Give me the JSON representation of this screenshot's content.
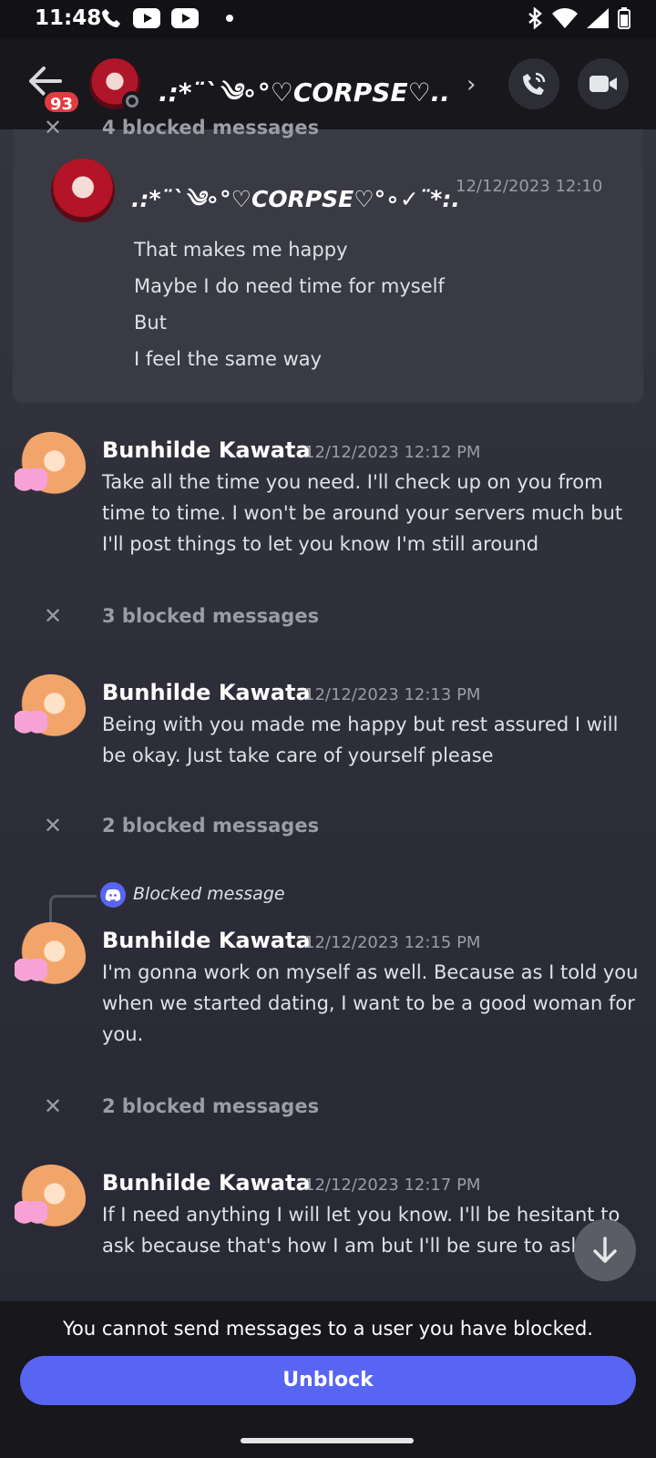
{
  "status_bar": {
    "time": "11:48"
  },
  "header": {
    "unread_badge": "93",
    "title": ".:*¨`༄∘°♡CORPSE♡...",
    "chevron": "›"
  },
  "context": {
    "cut_label": "4 blocked messages",
    "author": ".:*¨`༄∘°♡CORPSE♡°∘✓¨*:.",
    "timestamp": "12/12/2023 12:10",
    "lines": [
      "That makes me happy",
      "Maybe I do need time for myself",
      "But",
      "I feel the same way"
    ]
  },
  "messages": [
    {
      "author": "Bunhilde Kawata",
      "timestamp": "12/12/2023 12:12 PM",
      "text": "Take all the time you need. I'll check up on you from time to time. I won't be around your servers much but I'll post things to let you know I'm still around"
    },
    {
      "author": "Bunhilde Kawata",
      "timestamp": "12/12/2023 12:13 PM",
      "text": "Being with you made me happy but rest assured I will be okay. Just take care of yourself please"
    },
    {
      "author": "Bunhilde Kawata",
      "timestamp": "12/12/2023 12:15 PM",
      "text": "I'm gonna work on myself as well. Because as I told you when we started dating, I want to be a good woman for you."
    },
    {
      "author": "Bunhilde Kawata",
      "timestamp": "12/12/2023 12:17 PM",
      "text": "If I need anything I will let you know.  I'll be hesitant to ask because that's how I am but I'll be sure to ask"
    }
  ],
  "blocked": [
    "3 blocked messages",
    "2 blocked messages",
    "2 blocked messages"
  ],
  "reply_reference": "Blocked message",
  "footer": {
    "notice": "You cannot send messages to a user you have blocked.",
    "unblock_label": "Unblock"
  },
  "colors": {
    "accent": "#5865f2",
    "badge": "#e23b3f"
  }
}
